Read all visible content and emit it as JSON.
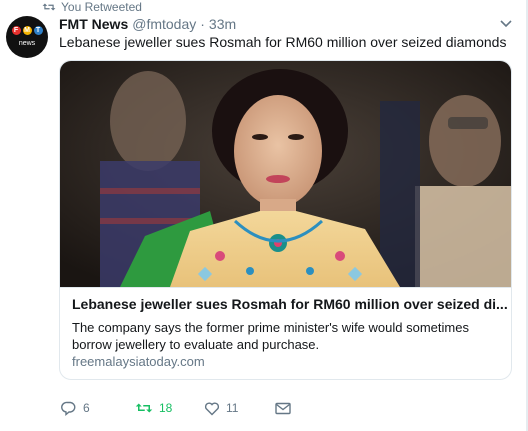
{
  "context": {
    "label": "You Retweeted",
    "icon": "retweet-icon"
  },
  "tweet": {
    "author_name": "FMT News",
    "author_handle": "@fmtoday",
    "separator": "·",
    "time": "33m",
    "text": "Lebanese jeweller sues Rosmah for RM60 million over seized diamonds",
    "avatar": {
      "letters": [
        "F",
        "M",
        "T"
      ],
      "caption": "news"
    }
  },
  "card": {
    "title": "Lebanese jeweller sues Rosmah for RM60 million over seized di...",
    "description": "The company says the former prime minister's wife would sometimes borrow jewellery to evaluate and purchase.",
    "domain": "freemalaysiatoday.com"
  },
  "actions": {
    "reply_count": "6",
    "retweet_count": "18",
    "like_count": "11"
  },
  "colors": {
    "accent_retweet": "#17bf63",
    "muted": "#657786",
    "border": "#e1e8ed"
  }
}
